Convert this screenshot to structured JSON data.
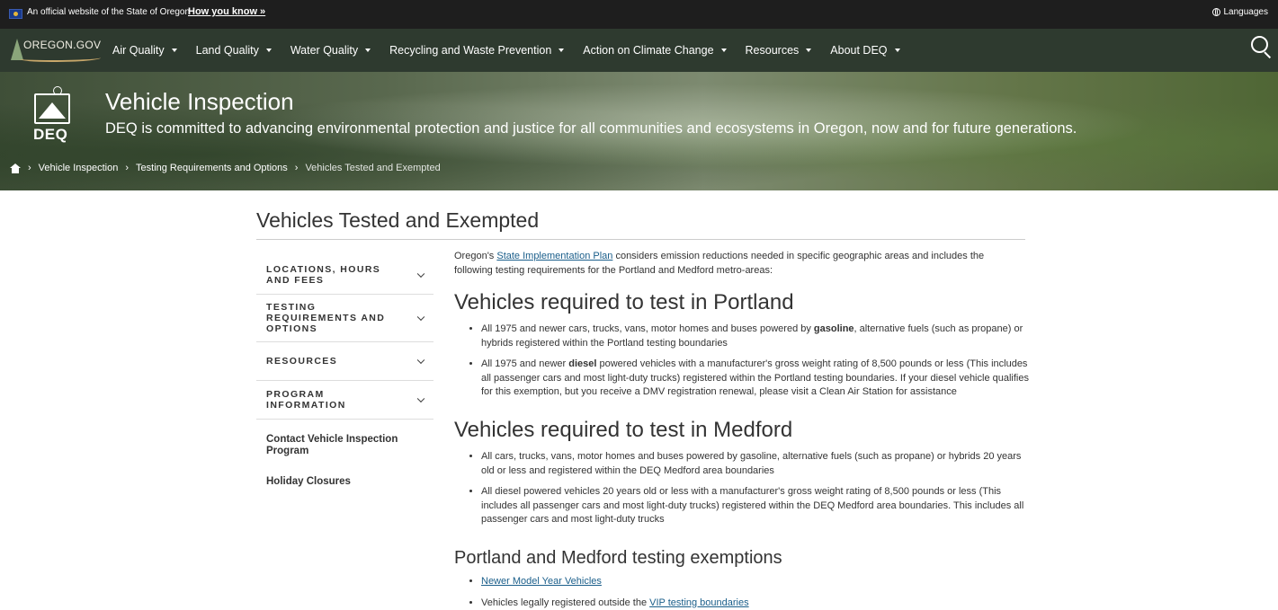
{
  "official_bar": {
    "text": "An official website of the State of Oregon",
    "how_link": "How you know »",
    "languages": "Languages"
  },
  "nav": {
    "logo_text": "OREGON.GOV",
    "items": [
      {
        "label": "Air Quality"
      },
      {
        "label": "Land Quality"
      },
      {
        "label": "Water Quality"
      },
      {
        "label": "Recycling and Waste Prevention"
      },
      {
        "label": "Action on Climate Change"
      },
      {
        "label": "Resources"
      },
      {
        "label": "About DEQ"
      }
    ]
  },
  "banner": {
    "logo_text": "DEQ",
    "title": "Vehicle Inspection",
    "tagline": "DEQ is committed to advancing environmental protection and justice for all communities and ecosystems in Oregon, now and for future generations."
  },
  "breadcrumb": [
    "Vehicle Inspection",
    "Testing Requirements and Options",
    "Vehicles Tested and Exempted"
  ],
  "page_title": "Vehicles Tested and Exempted",
  "sidebar": {
    "accordions": [
      {
        "label": "LOCATIONS, HOURS AND FEES"
      },
      {
        "label": "TESTING REQUIREMENTS AND OPTIONS"
      },
      {
        "label": "RESOURCES"
      },
      {
        "label": "PROGRAM INFORMATION"
      }
    ],
    "links": [
      "Contact Vehicle Inspection Program",
      "Holiday Closures"
    ]
  },
  "content": {
    "intro_pre": "Oregon's ",
    "intro_link": "State Implementation Plan",
    "intro_post": " considers emission reductions needed in specific geographic areas and includes the following testing requirements for the Portland and Medford metro-areas:",
    "portland_heading": "Vehicles required to test in Portland",
    "portland_b1_pre": "All 1975 and newer cars, trucks, vans, motor homes and buses powered by ",
    "portland_b1_bold": "gasoline",
    "portland_b1_post": ", alternative fuels (such as propane) or hybrids registered within the Portland testing boundaries",
    "portland_b2_pre": "All 1975 and newer ",
    "portland_b2_bold": "diesel",
    "portland_b2_post": " powered vehicles with a manufacturer's gross weight rating of 8,500 pounds or less (This includes all passenger cars and most light-duty trucks) registered within the Portland testing boundaries. If your diesel vehicle qualifies for this exemption, but you receive a DMV registration renewal, please visit a Clean Air Station for assistance",
    "medford_heading": "Vehicles required to test in Medford",
    "medford_b1": "All cars, trucks, vans, motor homes and buses powered by gasoline, alternative fuels (such as propane) or hybrids 20 years old or less and registered within the DEQ Medford area boundaries",
    "medford_b2": "All diesel powered vehicles 20 years old or less with a manufacturer's gross weight rating of 8,500 pounds or less (This includes all passenger cars and most light-duty trucks) registered within the DEQ Medford area boundaries. This includes all passenger cars and most light-duty trucks",
    "exemptions_heading": "Portland and Medford testing exemptions",
    "exemption_link1": "Newer Model Year Vehicles",
    "exemption2_pre": "Vehicles legally registered outside the ",
    "exemption2_link": "VIP testing boundaries"
  }
}
